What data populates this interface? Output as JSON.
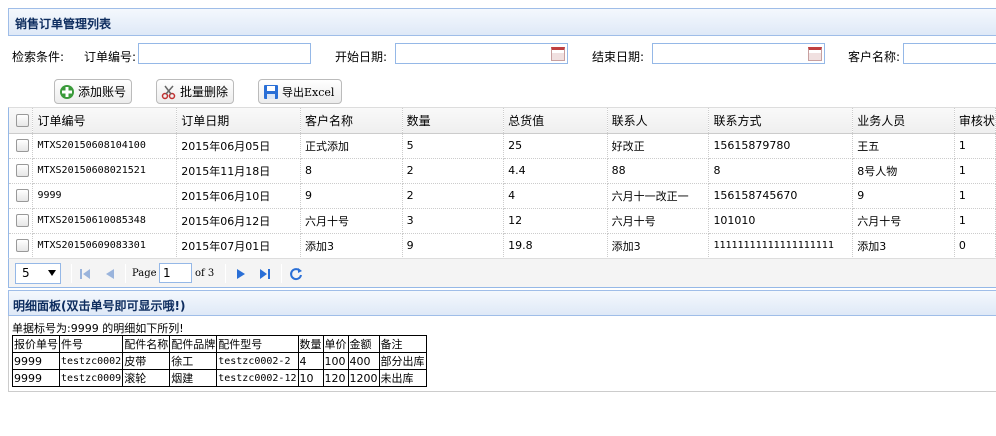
{
  "panel": {
    "title": "销售订单管理列表"
  },
  "search": {
    "label": "检索条件:",
    "order_no_label": "订单编号:",
    "start_date_label": "开始日期:",
    "end_date_label": "结束日期:",
    "customer_label": "客户名称:",
    "order_no_value": "",
    "start_date_value": "",
    "end_date_value": "",
    "customer_value": ""
  },
  "toolbar": {
    "add_label": "添加账号",
    "batch_delete_label": "批量删除",
    "export_label": "导出Excel"
  },
  "grid": {
    "columns": [
      "订单编号",
      "订单日期",
      "客户名称",
      "数量",
      "总货值",
      "联系人",
      "联系方式",
      "业务人员",
      "审核状"
    ],
    "rows": [
      [
        "MTXS20150608104100",
        "2015年06月05日",
        "正式添加",
        "5",
        "25",
        "好改正",
        "15615879780",
        "王五",
        "1"
      ],
      [
        "MTXS20150608021521",
        "2015年11月18日",
        "8",
        "2",
        "4.4",
        "88",
        "8",
        "8号人物",
        "1"
      ],
      [
        "9999",
        "2015年06月10日",
        "9",
        "2",
        "4",
        "六月十一改正一",
        "156158745670",
        "9",
        "1"
      ],
      [
        "MTXS20150610085348",
        "2015年06月12日",
        "六月十号",
        "3",
        "12",
        "六月十号",
        "101010",
        "六月十号",
        "1"
      ],
      [
        "MTXS20150609083301",
        "2015年07月01日",
        "添加3",
        "9",
        "19.8",
        "添加3",
        "11111111111111111111",
        "添加3",
        "0"
      ]
    ]
  },
  "pager": {
    "page_size": "5",
    "page_label": "Page",
    "current_page": "1",
    "of_label": "of 3"
  },
  "detail": {
    "title": "明细面板(双击单号即可显示哦!)",
    "caption": "单据标号为:9999 的明细如下所列!",
    "columns": [
      "报价单号",
      "件号",
      "配件名称",
      "配件品牌",
      "配件型号",
      "数量",
      "单价",
      "金额",
      "备注"
    ],
    "rows": [
      [
        "9999",
        "testzc0002",
        "皮带",
        "徐工",
        "testzc0002-2",
        "4",
        "100",
        "400",
        "部分出库"
      ],
      [
        "9999",
        "testzc0009",
        "滚轮",
        "烟建",
        "testzc0002-12",
        "10",
        "120",
        "1200",
        "未出库"
      ]
    ]
  },
  "colors": {
    "panel_border": "#95b8e7",
    "title_text": "#0e2d5f",
    "icon_blue": "#2a6fd6"
  }
}
